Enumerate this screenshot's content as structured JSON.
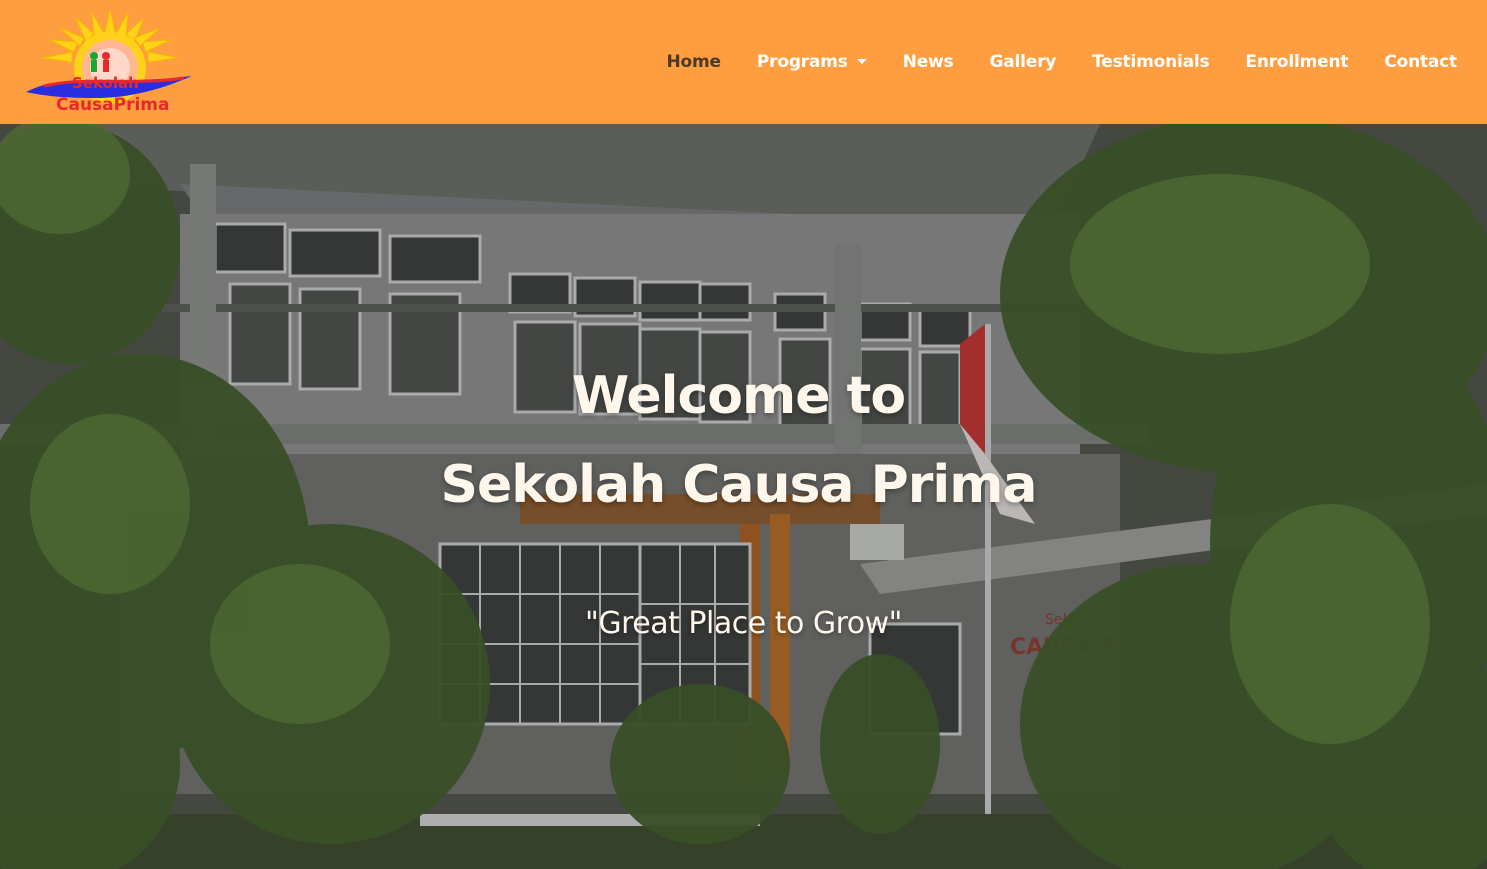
{
  "brand": {
    "logo_text_line1": "Sekolah",
    "logo_text_line2": "CausaPrima",
    "colors": {
      "navbar": "#ff9e40",
      "active_link": "#4a3a26",
      "link": "#ffffff"
    }
  },
  "nav": {
    "items": [
      {
        "label": "Home",
        "active": true
      },
      {
        "label": "Programs",
        "dropdown": true
      },
      {
        "label": "News"
      },
      {
        "label": "Gallery"
      },
      {
        "label": "Testimonials"
      },
      {
        "label": "Enrollment"
      },
      {
        "label": "Contact"
      }
    ]
  },
  "hero": {
    "title_line1": "Welcome to",
    "title_line2": "Sekolah Causa Prima",
    "subtitle": "\"Great Place to Grow\"",
    "building_sign_line1": "Sekolah",
    "building_sign_line2": "CAUSA PRIMA"
  }
}
